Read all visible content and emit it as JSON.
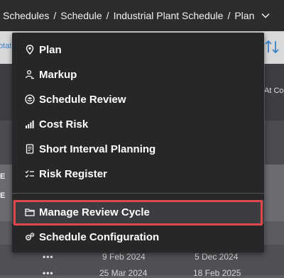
{
  "breadcrumb": {
    "items": [
      "Schedules",
      "Schedule",
      "Industrial Plant Schedule",
      "Plan"
    ],
    "separator": "/"
  },
  "background": {
    "toolbar_link": "otat",
    "header_cell_right": "At Co",
    "row_labels": [
      "E",
      "E"
    ],
    "rows": [
      {
        "start": "9 Feb 2024",
        "end": "5 Dec 2024"
      },
      {
        "start": "25 Mar 2024",
        "end": "18 Feb 2025"
      }
    ],
    "dots": "•••"
  },
  "menu": {
    "items": [
      {
        "label": "Plan",
        "icon": "location-pin-icon"
      },
      {
        "label": "Markup",
        "icon": "person-markup-icon"
      },
      {
        "label": "Schedule Review",
        "icon": "layers-icon"
      },
      {
        "label": "Cost Risk",
        "icon": "signal-bars-icon"
      },
      {
        "label": "Short Interval Planning",
        "icon": "document-icon"
      },
      {
        "label": "Risk Register",
        "icon": "checklist-icon"
      },
      {
        "label": "Manage Review Cycle",
        "icon": "folder-cycle-icon"
      },
      {
        "label": "Schedule Configuration",
        "icon": "gears-icon"
      }
    ],
    "highlighted": "Manage Review Cycle"
  },
  "colors": {
    "menu_bg": "#262729",
    "highlight_border": "#e0474c",
    "topbar_bg": "#2b2c2e"
  }
}
